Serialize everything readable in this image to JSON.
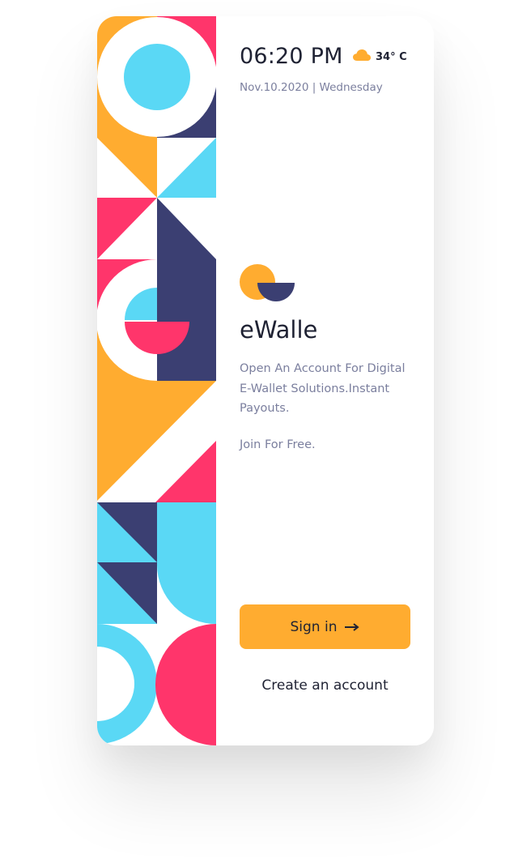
{
  "status": {
    "time": "06:20 PM",
    "weather_icon": "cloud-icon",
    "temperature": "34° C",
    "date": "Nov.10.2020 | Wednesday"
  },
  "brand": {
    "logo_icon": "ewalle-logo-icon",
    "name": "eWalle",
    "tagline": "Open An Account For Digital E-Wallet Solutions.Instant Payouts.",
    "join_text": "Join For Free."
  },
  "actions": {
    "signin_label": "Sign in",
    "signin_icon": "arrow-right-icon",
    "create_label": "Create an account"
  },
  "colors": {
    "orange": "#ffac30",
    "cyan": "#5ad8f5",
    "navy": "#3b3f72",
    "pink": "#ff356b",
    "text_dark": "#1f2233",
    "text_muted": "#7b7f9e"
  }
}
